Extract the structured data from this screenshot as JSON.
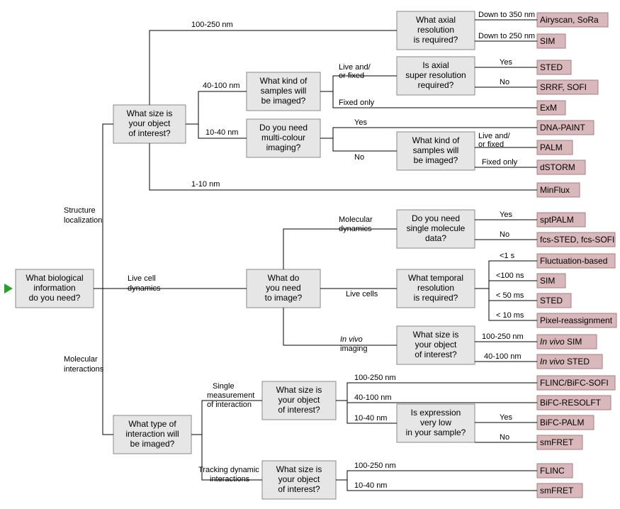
{
  "chart_data": {
    "type": "decision-tree",
    "title": "",
    "root": "What biological information do you need?",
    "branches": [
      {
        "label": "Structure localization",
        "node": "What size is your object of interest?",
        "children": [
          {
            "label": "100-250 nm",
            "node": "What axial resolution is required?",
            "children": [
              {
                "label": "Down to 350 nm",
                "leaf": "Airyscan, SoRa"
              },
              {
                "label": "Down to 250 nm",
                "leaf": "SIM"
              }
            ]
          },
          {
            "label": "40-100 nm",
            "node": "What kind of samples will be imaged?",
            "children": [
              {
                "label": "Live and/ or fixed",
                "node": "Is axial super resolution required?",
                "children": [
                  {
                    "label": "Yes",
                    "leaf": "STED"
                  },
                  {
                    "label": "No",
                    "leaf": "SRRF, SOFI"
                  }
                ]
              },
              {
                "label": "Fixed only",
                "leaf": "ExM"
              }
            ]
          },
          {
            "label": "10-40 nm",
            "node": "Do you need multi-colour imaging?",
            "children": [
              {
                "label": "Yes",
                "leaf": "DNA-PAINT"
              },
              {
                "label": "No",
                "node": "What kind of samples will be imaged?",
                "children": [
                  {
                    "label": "Live and/ or fixed",
                    "leaf": "PALM"
                  },
                  {
                    "label": "Fixed only",
                    "leaf": "dSTORM"
                  }
                ]
              }
            ]
          },
          {
            "label": "1-10 nm",
            "leaf": "MinFlux"
          }
        ]
      },
      {
        "label": "Live cell dynamics",
        "node": "What do you need to image?",
        "children": [
          {
            "label": "Molecular dynamics",
            "node": "Do you need single molecule data?",
            "children": [
              {
                "label": "Yes",
                "leaf": "sptPALM"
              },
              {
                "label": "No",
                "leaf": "fcs-STED, fcs-SOFI"
              }
            ]
          },
          {
            "label": "Live cells",
            "node": "What temporal resolution is required?",
            "children": [
              {
                "label": "<1 s",
                "leaf": "Fluctuation-based"
              },
              {
                "label": "<100 ns",
                "leaf": "SIM"
              },
              {
                "label": "< 50 ms",
                "leaf": "STED"
              },
              {
                "label": "< 10 ms",
                "leaf": "Pixel-reassignment"
              }
            ]
          },
          {
            "label": "In vivo imaging",
            "node": "What size is your object of interest?",
            "children": [
              {
                "label": "100-250 nm",
                "leaf": "In vivo SIM"
              },
              {
                "label": "40-100 nm",
                "leaf": "In vivo STED"
              }
            ]
          }
        ]
      },
      {
        "label": "Molecular interactions",
        "node": "What type of interaction will be imaged?",
        "children": [
          {
            "label": "Single measurement of interaction",
            "node": "What size is your object of interest?",
            "children": [
              {
                "label": "100-250 nm",
                "leaf": "FLINC/BiFC-SOFI"
              },
              {
                "label": "40-100 nm",
                "leaf": "BiFC-RESOLFT"
              },
              {
                "label": "10-40 nm",
                "node": "Is expression very low in your sample?",
                "children": [
                  {
                    "label": "Yes",
                    "leaf": "BiFC-PALM"
                  },
                  {
                    "label": "No",
                    "leaf": "smFRET"
                  }
                ]
              }
            ]
          },
          {
            "label": "Tracking dynamic interactions",
            "node": "What size is your object of interest?",
            "children": [
              {
                "label": "100-250 nm",
                "leaf": "FLINC"
              },
              {
                "label": "10-40 nm",
                "leaf": "smFRET"
              }
            ]
          }
        ]
      }
    ]
  },
  "boxes": {
    "q_root": {
      "l1": "What biological",
      "l2": "information",
      "l3": "do you need?"
    },
    "q_size1": {
      "l1": "What size is",
      "l2": "your object",
      "l3": "of interest?"
    },
    "q_axial": {
      "l1": "What axial",
      "l2": "resolution",
      "l3": "is required?"
    },
    "q_kind1": {
      "l1": "What kind of",
      "l2": "samples will",
      "l3": "be imaged?"
    },
    "q_axsr": {
      "l1": "Is axial",
      "l2": "super resolution",
      "l3": "required?"
    },
    "q_multi": {
      "l1": "Do you need",
      "l2": "multi-colour",
      "l3": "imaging?"
    },
    "q_kind2": {
      "l1": "What kind of",
      "l2": "samples will",
      "l3": "be imaged?"
    },
    "q_image": {
      "l1": "What do",
      "l2": "you need",
      "l3": "to image?"
    },
    "q_smd": {
      "l1": "Do you need",
      "l2": "single molecule",
      "l3": "data?"
    },
    "q_temp": {
      "l1": "What temporal",
      "l2": "resolution",
      "l3": "is required?"
    },
    "q_size2": {
      "l1": "What size is",
      "l2": "your object",
      "l3": "of interest?"
    },
    "q_type": {
      "l1": "What type of",
      "l2": "interaction will",
      "l3": "be imaged?"
    },
    "q_size3": {
      "l1": "What size is",
      "l2": "your object",
      "l3": "of interest?"
    },
    "q_expr": {
      "l1": "Is expression",
      "l2": "very low",
      "l3": "in your sample?"
    },
    "q_size4": {
      "l1": "What size is",
      "l2": "your object",
      "l3": "of interest?"
    }
  },
  "results": {
    "r_airy": "Airyscan, SoRa",
    "r_sim1": "SIM",
    "r_sted1": "STED",
    "r_srrf": "SRRF, SOFI",
    "r_exm": "ExM",
    "r_dna": "DNA-PAINT",
    "r_palm": "PALM",
    "r_dstorm": "dSTORM",
    "r_min": "MinFlux",
    "r_spt": "sptPALM",
    "r_fcs": "fcs-STED, fcs-SOFI",
    "r_fluc": "Fluctuation-based",
    "r_sim2": "SIM",
    "r_sted2": "STED",
    "r_pixel": "Pixel-reassignment",
    "r_ivsim_pre": "In vivo ",
    "r_ivsim": "SIM",
    "r_ivsted_pre": "In vivo ",
    "r_ivsted": "STED",
    "r_flincb": "FLINC/BiFC-SOFI",
    "r_bres": "BiFC-RESOLFT",
    "r_bpalm": "BiFC-PALM",
    "r_smf1": "smFRET",
    "r_flinc": "FLINC",
    "r_smf2": "smFRET"
  },
  "labels": {
    "struct": "Structure",
    "struct2": "localization",
    "live": "Live cell",
    "live2": "dynamics",
    "mol": "Molecular",
    "mol2": "interactions",
    "nm100": "100-250 nm",
    "nm40": "40-100 nm",
    "nm10": "10-40 nm",
    "nm1": "1-10 nm",
    "d350": "Down to 350 nm",
    "d250": "Down to 250 nm",
    "lf1": "Live and/",
    "lf2": "or fixed",
    "fixed": "Fixed only",
    "yes": "Yes",
    "no": "No",
    "moldyn1": "Molecular",
    "moldyn2": "dynamics",
    "livec": "Live cells",
    "invivo1": "In vivo",
    "invivo2": "imaging",
    "t1": "<1 s",
    "t100": "<100 ns",
    "t50": "< 50 ms",
    "t10": "< 10 ms",
    "single1": "Single",
    "single2": "measurement",
    "single3": "of interaction",
    "track1": "Tracking dynamic",
    "track2": "interactions"
  }
}
